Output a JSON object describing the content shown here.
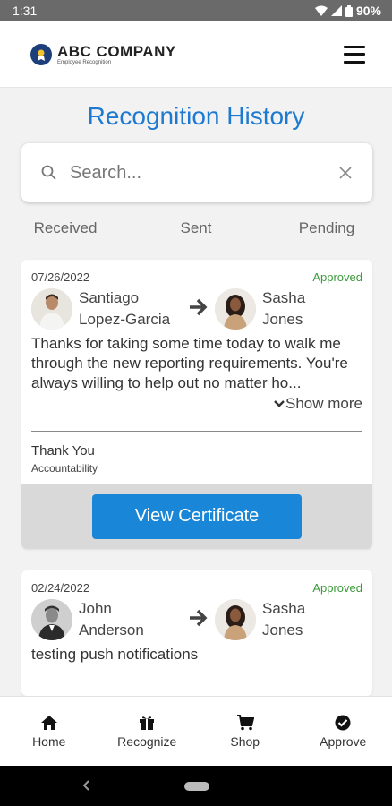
{
  "status_bar": {
    "time": "1:31",
    "battery": "90%"
  },
  "header": {
    "company_name": "ABC COMPANY",
    "company_subtitle": "Employee Recognition"
  },
  "page": {
    "title": "Recognition History"
  },
  "search": {
    "placeholder": "Search..."
  },
  "tabs": [
    {
      "label": "Received",
      "active": true
    },
    {
      "label": "Sent",
      "active": false
    },
    {
      "label": "Pending",
      "active": false
    }
  ],
  "cards": [
    {
      "date": "07/26/2022",
      "status": "Approved",
      "sender": {
        "first": "Santiago",
        "last": "Lopez-Garcia"
      },
      "recipient": {
        "first": "Sasha",
        "last": "Jones"
      },
      "message": "Thanks for taking some time today to walk me through the new reporting requirements. You're always willing to help out no matter ho...",
      "show_more": "Show more",
      "value": "Thank You",
      "category": "Accountability",
      "certificate_button": "View Certificate"
    },
    {
      "date": "02/24/2022",
      "status": "Approved",
      "sender": {
        "first": "John",
        "last": "Anderson"
      },
      "recipient": {
        "first": "Sasha",
        "last": "Jones"
      },
      "message": "testing push notifications"
    }
  ],
  "bottom_nav": [
    {
      "label": "Home",
      "icon": "home-icon"
    },
    {
      "label": "Recognize",
      "icon": "gift-icon"
    },
    {
      "label": "Shop",
      "icon": "cart-icon"
    },
    {
      "label": "Approve",
      "icon": "check-circle-icon"
    }
  ],
  "colors": {
    "accent": "#1e7ad0",
    "button": "#1a86d8",
    "approved": "#3a9a3a",
    "status_bar": "#6a6a6a"
  }
}
